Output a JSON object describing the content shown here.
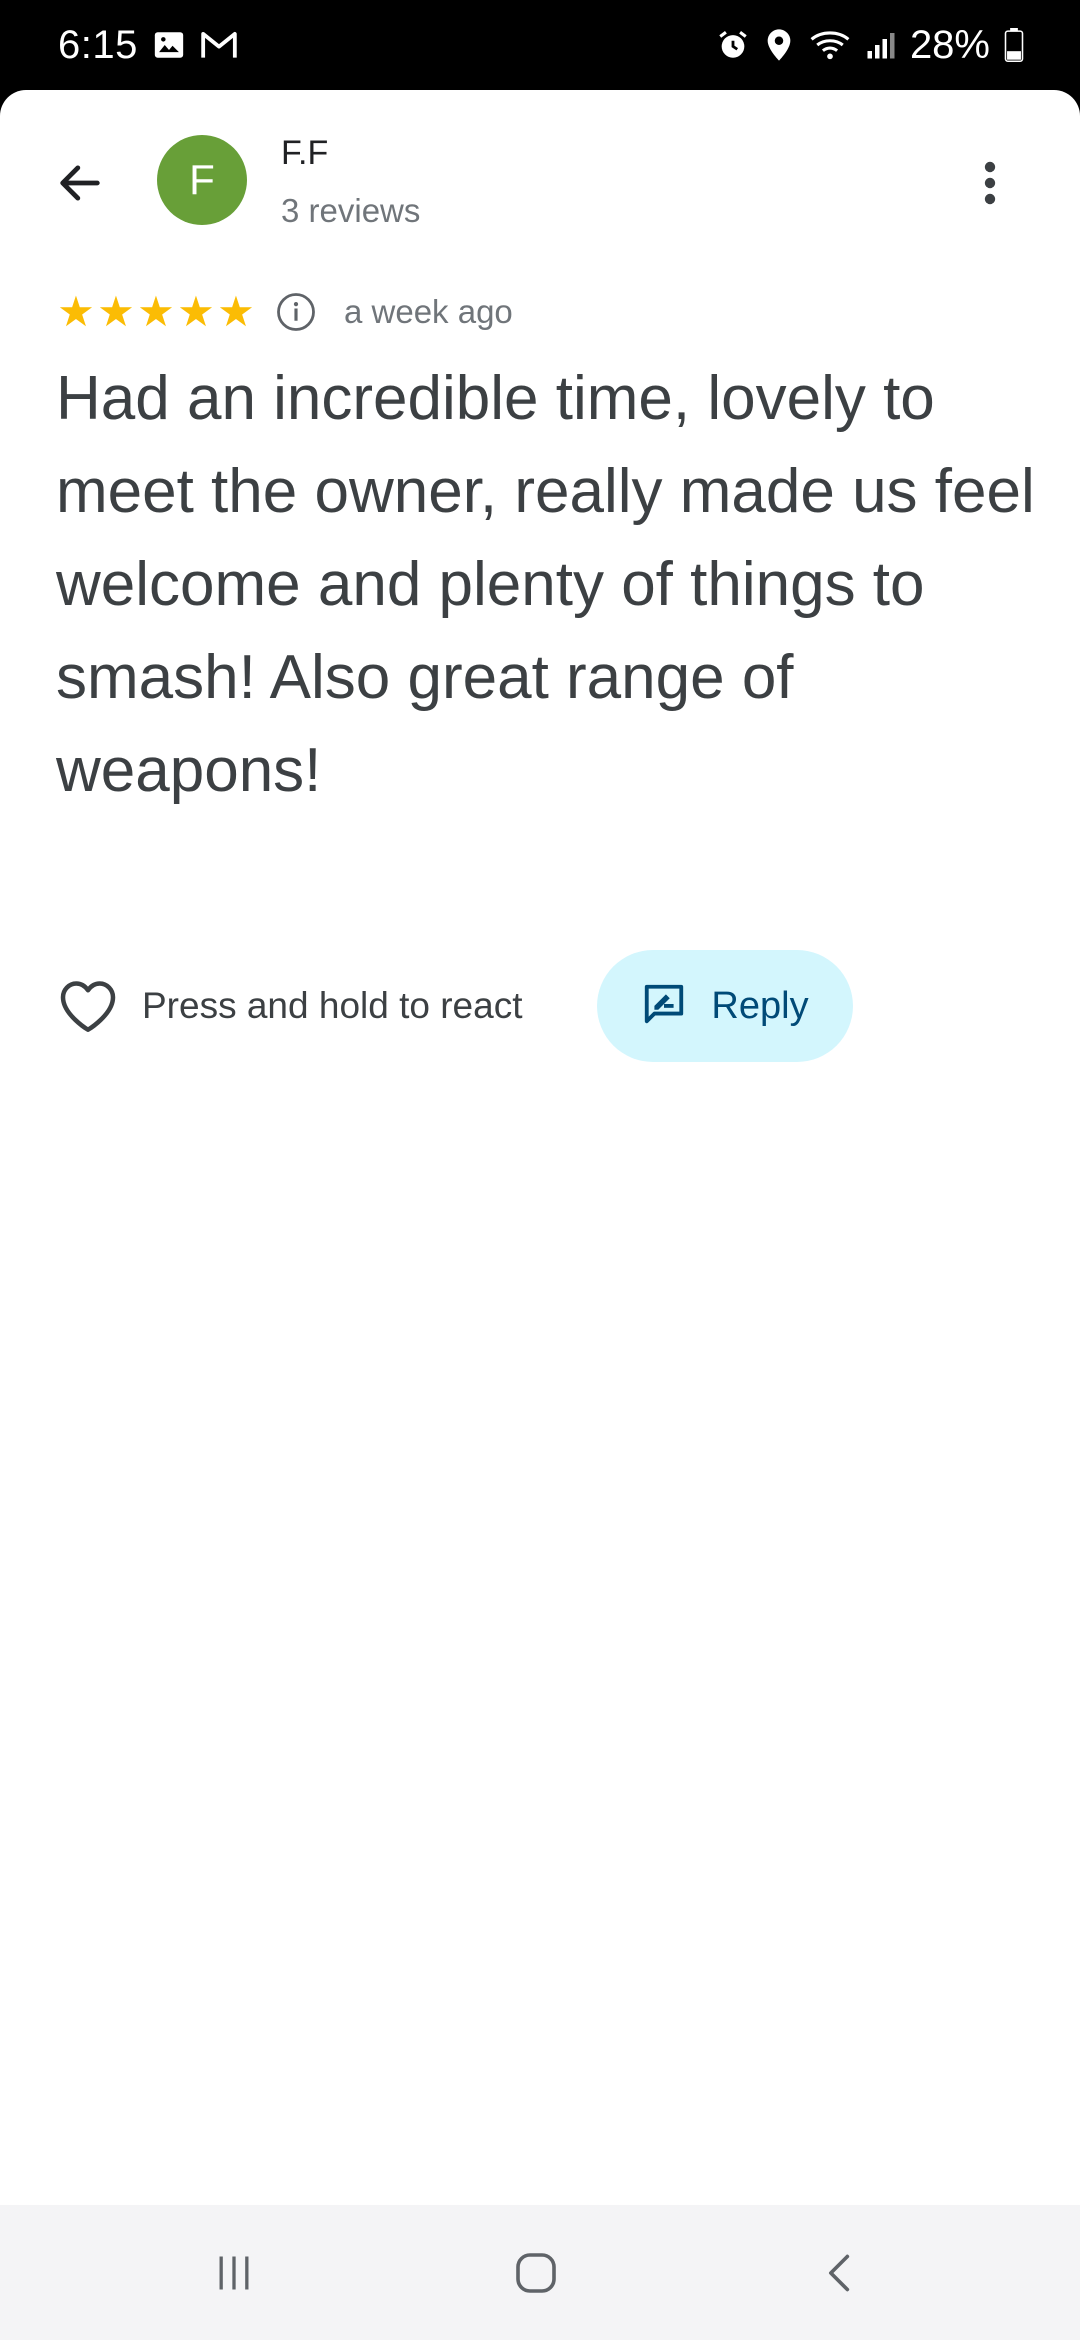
{
  "status_bar": {
    "time": "6:15",
    "battery": "28%",
    "icons": [
      "gallery-icon",
      "gmail-icon",
      "alarm-icon",
      "location-icon",
      "wifi-icon",
      "signal-icon",
      "battery-icon"
    ]
  },
  "header": {
    "avatar_letter": "F",
    "avatar_color": "#689f38",
    "reviewer_name": "F.F",
    "reviewer_count": "3 reviews"
  },
  "review": {
    "rating": 5,
    "rating_max": 5,
    "time": "a week ago",
    "text": "Had an incredible time, lovely to meet the owner, really made us feel welcome and plenty of things to smash! Also great range of weapons!"
  },
  "actions": {
    "react_label": "Press and hold to react",
    "reply_label": "Reply"
  },
  "colors": {
    "star": "#fbbc04",
    "reply_bg": "#d3f6fd",
    "reply_text": "#004a77"
  }
}
